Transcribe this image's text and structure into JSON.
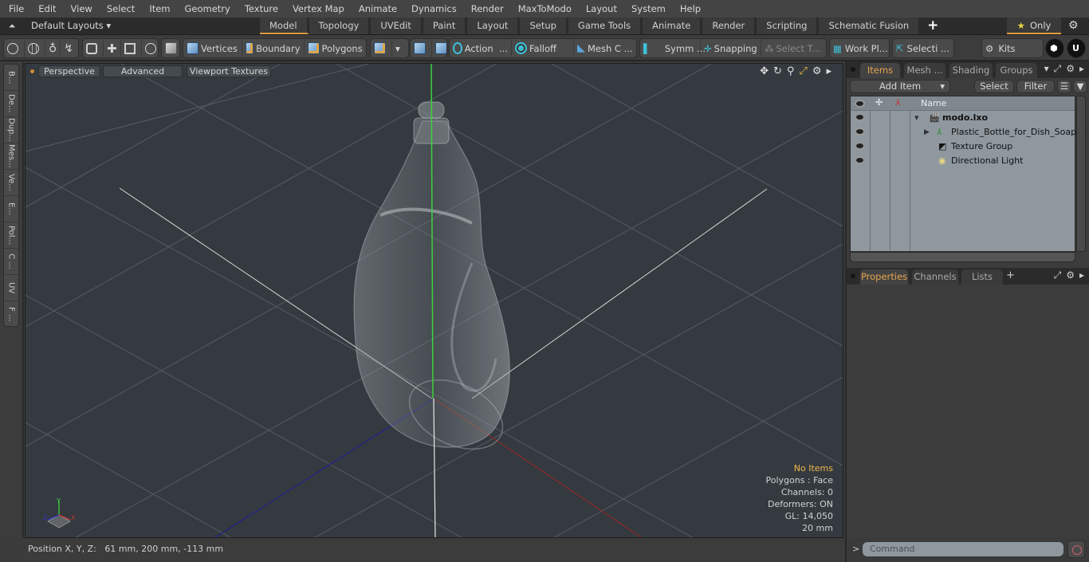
{
  "menu": [
    "File",
    "Edit",
    "View",
    "Select",
    "Item",
    "Geometry",
    "Texture",
    "Vertex Map",
    "Animate",
    "Dynamics",
    "Render",
    "MaxToModo",
    "Layout",
    "System",
    "Help"
  ],
  "layoutbar": {
    "layout_selector": "Default Layouts",
    "tabs": [
      "Model",
      "Topology",
      "UVEdit",
      "Paint",
      "Layout",
      "Setup",
      "Game Tools",
      "Animate",
      "Render",
      "Scripting",
      "Schematic Fusion"
    ],
    "active_tab": "Model",
    "add_tab": "+",
    "only_label": "Only"
  },
  "toolbar": {
    "vertices": "Vertices",
    "boundary": "Boundary",
    "polygons": "Polygons",
    "action": "Action",
    "action_more": "...",
    "falloff": "Falloff",
    "mesh_c": "Mesh C ...",
    "symm": "Symm ...",
    "snapping": "Snapping",
    "select_t": "Select T...",
    "work_pl": "Work Pl...",
    "selecti": "Selecti ...",
    "kits": "Kits"
  },
  "left_tabs": [
    "B...",
    "De...",
    "Dup...",
    "Mes...",
    "Ve...",
    "E...",
    "Pol...",
    "C ...",
    "UV",
    "F ..."
  ],
  "viewport": {
    "view_mode": "Perspective",
    "shading": "Advanced",
    "textures": "Viewport Textures",
    "info": {
      "selection": "No Items",
      "polygons": "Polygons : Face",
      "channels": "Channels: 0",
      "deformers": "Deformers: ON",
      "gl": "GL: 14,050",
      "scale": "20 mm"
    },
    "axis_labels": {
      "x": "X",
      "y": "Y",
      "z": "Z"
    }
  },
  "statusbar": {
    "label": "Position X, Y, Z:",
    "value": "61 mm, 200 mm, -113 mm"
  },
  "items_panel": {
    "tabs": [
      "Items",
      "Mesh ...",
      "Shading",
      "Groups"
    ],
    "active_tab": "Items",
    "add_item": "Add Item",
    "select": "Select",
    "filter": "Filter",
    "column_name": "Name",
    "tree": [
      {
        "label": "modo.lxo",
        "type": "scene",
        "bold": true
      },
      {
        "label": "Plastic_Bottle_for_Dish_Soap ...",
        "type": "mesh"
      },
      {
        "label": "Texture Group",
        "type": "texture"
      },
      {
        "label": "Directional Light",
        "type": "light"
      }
    ]
  },
  "properties_panel": {
    "tabs": [
      "Properties",
      "Channels",
      "Lists"
    ],
    "active_tab": "Properties",
    "add_tab": "+"
  },
  "command": {
    "prompt": ">",
    "placeholder": "Command"
  },
  "colors": {
    "accent": "#e39a3c",
    "info_highlight": "#f0b64e",
    "axis_x": "#8a2a2a",
    "axis_y": "#3fd03f",
    "axis_z": "#22228a"
  }
}
